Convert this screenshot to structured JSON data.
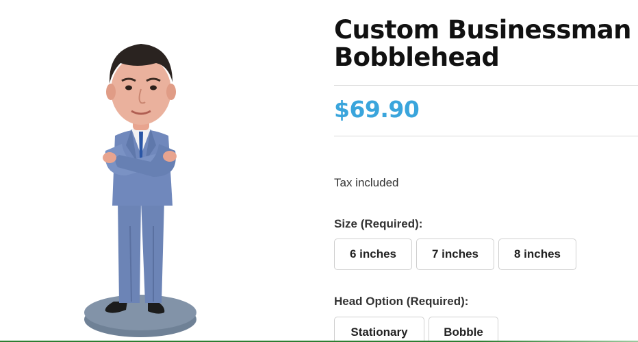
{
  "product": {
    "title": "Custom Businessman Bobblehead",
    "price": "$69.90",
    "tax_note": "Tax included",
    "image_subject": "businessman bobblehead figurine"
  },
  "options": {
    "size": {
      "label": "Size (Required):",
      "choices": [
        "6 inches",
        "7 inches",
        "8 inches"
      ]
    },
    "head": {
      "label": "Head Option (Required):",
      "choices": [
        "Stationary",
        "Bobble"
      ]
    }
  },
  "colors": {
    "price": "#3aa5dc",
    "title": "#111111",
    "suit": "#6f86b8",
    "base": "#7d8ea3"
  },
  "icons": [
    "businessman-bobblehead-figure"
  ]
}
